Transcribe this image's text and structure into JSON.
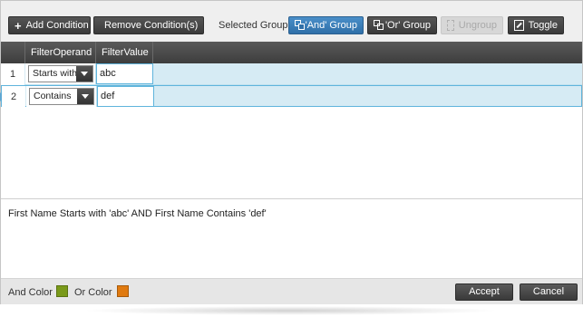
{
  "toolbar": {
    "add_condition": "Add Condition",
    "remove_conditions": "Remove Condition(s)",
    "selected_group_label": "Selected Group",
    "and_group": "'And' Group",
    "or_group": "'Or' Group",
    "ungroup": "Ungroup",
    "toggle": "Toggle"
  },
  "grid": {
    "columns": [
      "FilterOperand",
      "FilterValue"
    ],
    "rows": [
      {
        "num": "1",
        "operand": "Starts with",
        "value": "abc",
        "current": false
      },
      {
        "num": "2",
        "operand": "Contains",
        "value": "def",
        "current": true
      }
    ]
  },
  "expression": "First Name Starts with 'abc' AND First Name Contains 'def'",
  "footer": {
    "and_color_label": "And Color",
    "or_color_label": "Or Color",
    "and_color": "#7a9a1a",
    "or_color": "#e07a10",
    "accept": "Accept",
    "cancel": "Cancel"
  },
  "icons": {
    "add": "plus-icon",
    "remove": "minus-icon",
    "and_group": "group-and-icon",
    "or_group": "group-or-icon",
    "ungroup": "ungroup-icon",
    "toggle": "toggle-icon"
  }
}
